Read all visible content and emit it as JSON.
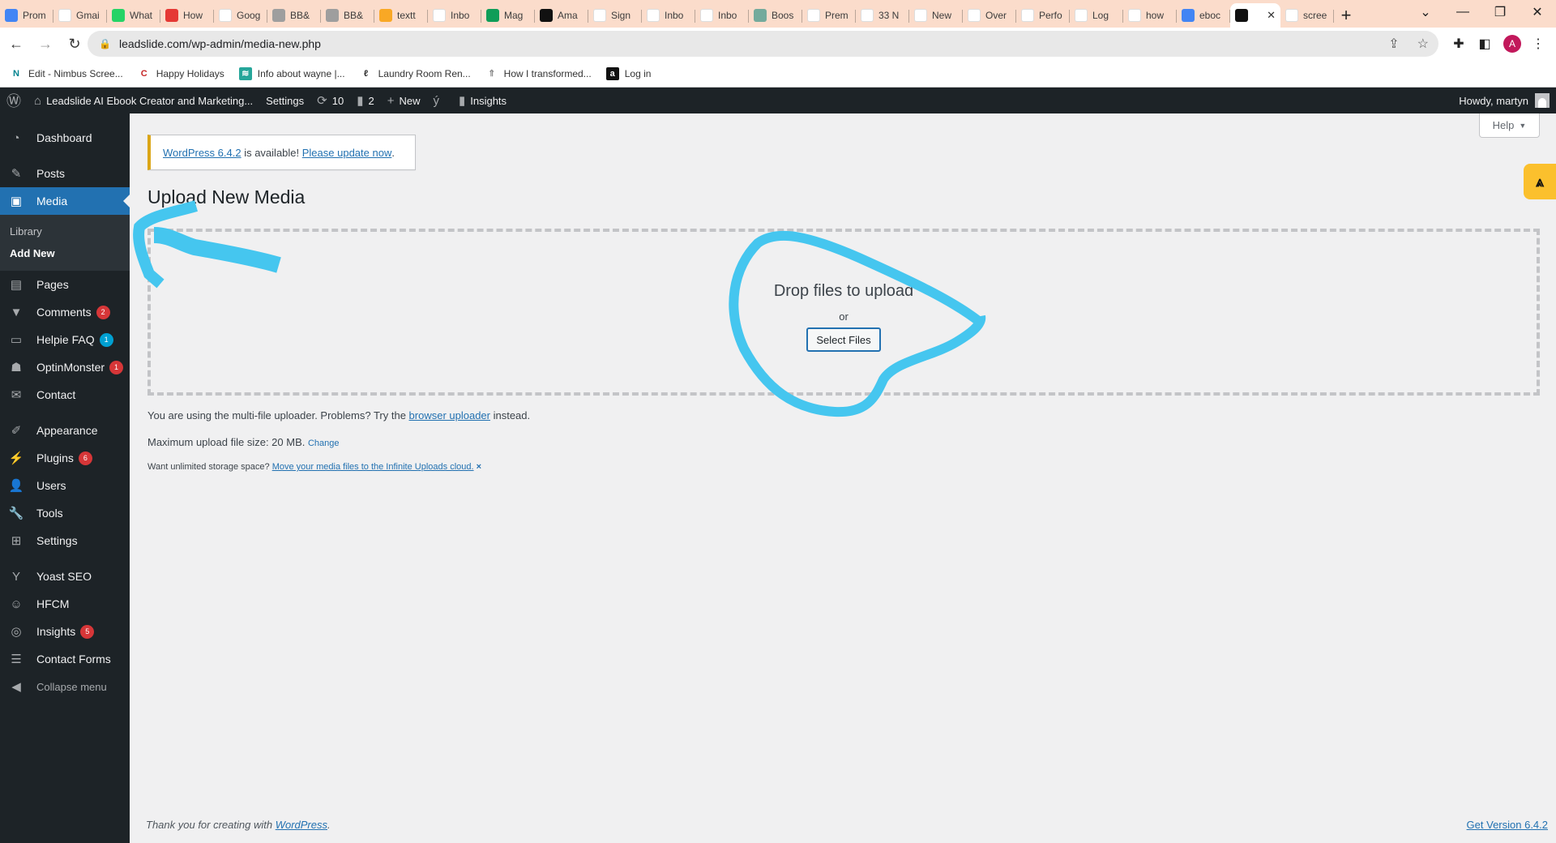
{
  "browser": {
    "tabs": [
      {
        "label": "Prom",
        "icon": "google-docs-icon",
        "color": "#4285f4"
      },
      {
        "label": "Gmai",
        "icon": "google-icon",
        "color": "#ffffff"
      },
      {
        "label": "What",
        "icon": "whatsapp-icon",
        "color": "#25d366"
      },
      {
        "label": "How",
        "icon": "ninja-icon",
        "color": "#e53935"
      },
      {
        "label": "Goog",
        "icon": "google-cloud-icon",
        "color": "#ffffff"
      },
      {
        "label": "BB&",
        "icon": "chrome-gear-icon",
        "color": "#9e9e9e"
      },
      {
        "label": "BB&",
        "icon": "chrome-gear-icon",
        "color": "#9e9e9e"
      },
      {
        "label": "textt",
        "icon": "infinity-icon",
        "color": "#f9a825"
      },
      {
        "label": "Inbo",
        "icon": "gmail-icon",
        "color": "#ffffff"
      },
      {
        "label": "Mag",
        "icon": "sheets-plus-icon",
        "color": "#0f9d58"
      },
      {
        "label": "Ama",
        "icon": "amazon-icon",
        "color": "#111111"
      },
      {
        "label": "Sign",
        "icon": "google-icon",
        "color": "#ffffff"
      },
      {
        "label": "Inbo",
        "icon": "gmail-icon",
        "color": "#ffffff"
      },
      {
        "label": "Inbo",
        "icon": "gmail-icon",
        "color": "#ffffff"
      },
      {
        "label": "Boos",
        "icon": "chatgpt-icon",
        "color": "#74aa9c"
      },
      {
        "label": "Prem",
        "icon": "cart-icon",
        "color": "#ffffff"
      },
      {
        "label": "33 N",
        "icon": "cart-icon",
        "color": "#ffffff"
      },
      {
        "label": "New",
        "icon": "chrome-icon",
        "color": "#ffffff"
      },
      {
        "label": "Over",
        "icon": "lighthouse-icon",
        "color": "#ffffff"
      },
      {
        "label": "Perfo",
        "icon": "lighthouse-icon",
        "color": "#ffffff"
      },
      {
        "label": "Log",
        "icon": "grid-logo-icon",
        "color": "#ffffff"
      },
      {
        "label": "how",
        "icon": "google-icon",
        "color": "#ffffff"
      },
      {
        "label": "eboc",
        "icon": "google-docs-icon",
        "color": "#4285f4"
      },
      {
        "label": "",
        "icon": "chart-logo-icon",
        "color": "#111111",
        "active": true
      },
      {
        "label": "scree",
        "icon": "google-icon",
        "color": "#ffffff"
      }
    ],
    "new_tab": "+",
    "url": "leadslide.com/wp-admin/media-new.php",
    "profile_initial": "A",
    "bookmarks": [
      {
        "label": "Edit - Nimbus Scree...",
        "icon": "N"
      },
      {
        "label": "Happy Holidays",
        "icon": "C"
      },
      {
        "label": "Info about wayne |...",
        "icon": "≋"
      },
      {
        "label": "Laundry Room Ren...",
        "icon": "ℓ"
      },
      {
        "label": "How I transformed...",
        "icon": "⇑"
      },
      {
        "label": "Log in",
        "icon": "a"
      }
    ]
  },
  "adminbar": {
    "site_name": "Leadslide AI Ebook Creator and Marketing...",
    "settings": "Settings",
    "updates_count": "10",
    "comments_count": "2",
    "new_label": "New",
    "insights_label": "Insights",
    "howdy": "Howdy, martyn"
  },
  "sidebar": {
    "items": [
      {
        "label": "Dashboard",
        "icon": "dashboard-icon",
        "glyph": "◔"
      },
      {
        "label": "Posts",
        "icon": "pin-icon",
        "glyph": "✎"
      },
      {
        "label": "Media",
        "icon": "media-icon",
        "glyph": "▣",
        "current": true
      },
      {
        "label": "Pages",
        "icon": "pages-icon",
        "glyph": "▤"
      },
      {
        "label": "Comments",
        "icon": "comment-icon",
        "glyph": "▼",
        "badge": "2"
      },
      {
        "label": "Helpie FAQ",
        "icon": "faq-icon",
        "glyph": "▭",
        "badge": "1",
        "badge_color": "#00a0d2"
      },
      {
        "label": "OptinMonster",
        "icon": "monster-icon",
        "glyph": "☗",
        "badge": "1"
      },
      {
        "label": "Contact",
        "icon": "envelope-icon",
        "glyph": "✉"
      },
      {
        "label": "Appearance",
        "icon": "brush-icon",
        "glyph": "✐"
      },
      {
        "label": "Plugins",
        "icon": "plug-icon",
        "glyph": "⚡",
        "badge": "6"
      },
      {
        "label": "Users",
        "icon": "user-icon",
        "glyph": "👤"
      },
      {
        "label": "Tools",
        "icon": "wrench-icon",
        "glyph": "🔧"
      },
      {
        "label": "Settings",
        "icon": "settings-icon",
        "glyph": "⊞"
      },
      {
        "label": "Yoast SEO",
        "icon": "yoast-icon",
        "glyph": "Y"
      },
      {
        "label": "HFCM",
        "icon": "robot-icon",
        "glyph": "☺"
      },
      {
        "label": "Insights",
        "icon": "insights-icon",
        "glyph": "◎",
        "badge": "5"
      },
      {
        "label": "Contact Forms",
        "icon": "form-icon",
        "glyph": "☰"
      }
    ],
    "media_submenu": [
      "Library",
      "Add New"
    ],
    "collapse": "Collapse menu"
  },
  "content": {
    "help": "Help",
    "notice": {
      "version_link": "WordPress 6.4.2",
      "middle": " is available! ",
      "update_link": "Please update now",
      "end": "."
    },
    "title": "Upload New Media",
    "dropzone": {
      "title": "Drop files to upload",
      "or": "or",
      "button": "Select Files"
    },
    "uploader_text": "You are using the multi-file uploader. Problems? Try the ",
    "uploader_link": "browser uploader",
    "uploader_end": " instead.",
    "max_size": "Maximum upload file size: 20 MB.",
    "change": "Change",
    "storage_text": "Want unlimited storage space? ",
    "storage_link": "Move your media files to the Infinite Uploads cloud.",
    "storage_dismiss": "×",
    "footer_text": "Thank you for creating with ",
    "footer_link": "WordPress",
    "footer_end": ".",
    "get_version": "Get Version 6.4.2"
  },
  "colors": {
    "accent": "#2271b1",
    "admin_bar": "#1d2327",
    "notice_border": "#dba617",
    "annotation": "#45c6ef",
    "badge_red": "#d63638"
  }
}
